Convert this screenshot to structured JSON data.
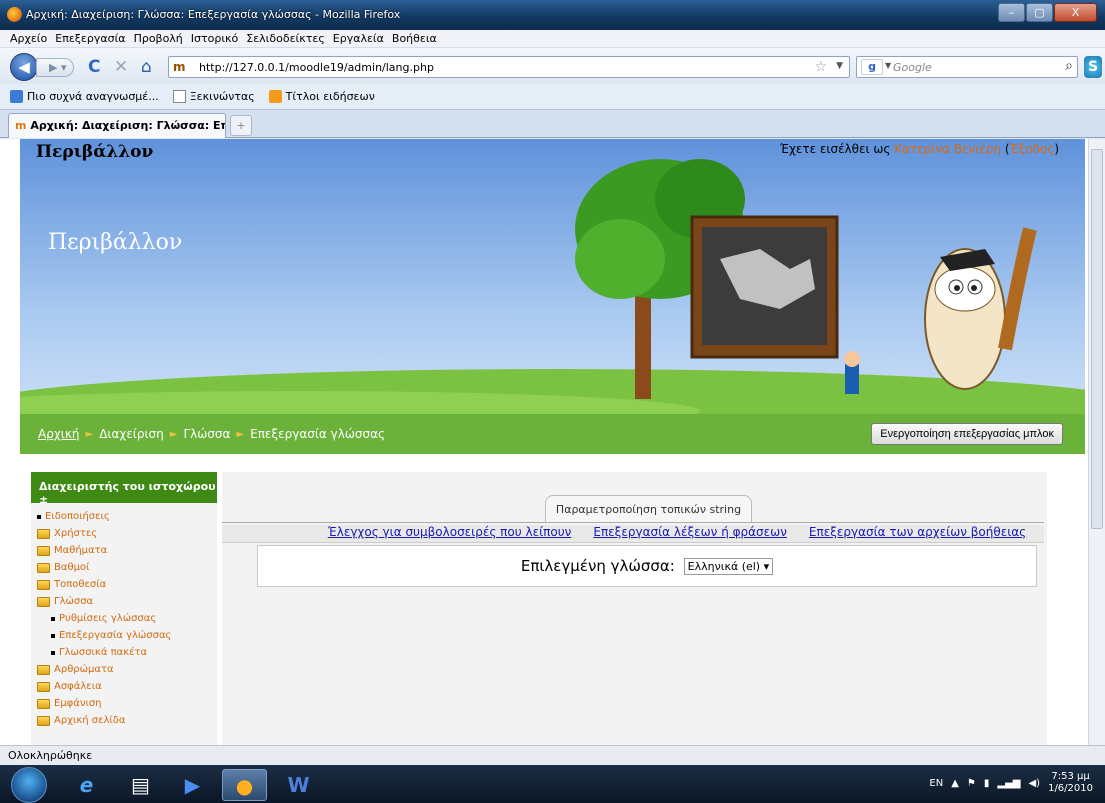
{
  "window": {
    "title": "Αρχική: Διαχείριση: Γλώσσα: Επεξεργασία γλώσσας - Mozilla Firefox",
    "controls": [
      "–",
      "▢",
      "X"
    ]
  },
  "menu": [
    "Αρχείο",
    "Επεξεργασία",
    "Προβολή",
    "Ιστορικό",
    "Σελιδοδείκτες",
    "Εργαλεία",
    "Βοήθεια"
  ],
  "nav": {
    "url": "http://127.0.0.1/moodle19/admin/lang.php",
    "site_icon": "m",
    "search_placeholder": "Google",
    "search_engine_icon": "g"
  },
  "bookmarks": [
    "Πιο συχνά αναγνωσμέ...",
    "Ξεκινώντας",
    "Τίτλοι ειδήσεων"
  ],
  "tab": {
    "label": "Αρχική: Διαχείριση: Γλώσσα: Επεξερ...",
    "site_icon": "m",
    "new_tab": "+"
  },
  "header": {
    "site_name": "Περιβάλλον",
    "banner_title": "Περιβάλλον",
    "logged_in_prefix": "Έχετε εισέλθει ως",
    "user_name": "Κατερίνα Βενιέρη",
    "open_paren": "(",
    "logout_label": "Έξοδος",
    "close_paren": ")"
  },
  "breadcrumb": {
    "items": [
      "Αρχική",
      "Διαχείριση",
      "Γλώσσα",
      "Επεξεργασία γλώσσας"
    ],
    "separator": "►",
    "edit_button": "Ενεργοποίηση επεξεργασίας μπλοκ"
  },
  "sidebar": {
    "title": "Διαχειριστής του ιστοχώρου",
    "title_icon": "±",
    "items": [
      {
        "label": "Ειδοποιήσεις",
        "icon": "bullet",
        "level": 0
      },
      {
        "label": "Χρήστες",
        "icon": "folder",
        "level": 0
      },
      {
        "label": "Μαθήματα",
        "icon": "folder",
        "level": 0
      },
      {
        "label": "Βαθμοί",
        "icon": "folder",
        "level": 0
      },
      {
        "label": "Τοποθεσία",
        "icon": "folder",
        "level": 0
      },
      {
        "label": "Γλώσσα",
        "icon": "folder-open",
        "level": 0
      },
      {
        "label": "Ρυθμίσεις γλώσσας",
        "icon": "bullet",
        "level": 1
      },
      {
        "label": "Επεξεργασία γλώσσας",
        "icon": "bullet",
        "level": 1
      },
      {
        "label": "Γλωσσικά πακέτα",
        "icon": "bullet",
        "level": 1
      },
      {
        "label": "Αρθρώματα",
        "icon": "folder",
        "level": 0
      },
      {
        "label": "Ασφάλεια",
        "icon": "folder",
        "level": 0
      },
      {
        "label": "Εμφάνιση",
        "icon": "folder",
        "level": 0
      },
      {
        "label": "Αρχική σελίδα",
        "icon": "folder",
        "level": 0
      }
    ]
  },
  "main": {
    "tab_label": "Παραμετροποίηση τοπικών string",
    "links": [
      "Έλεγχος για συμβολοσειρές που λείπουν",
      "Επεξεργασία λέξεων ή φράσεων",
      "Επεξεργασία των αρχείων βοήθειας"
    ],
    "lang_label": "Επιλεγμένη γλώσσα:",
    "lang_selected": "Ελληνικά (el)"
  },
  "status": "Ολοκληρώθηκε",
  "taskbar": {
    "lang": "EN",
    "time": "7:53 μμ",
    "date": "1/6/2010"
  },
  "colors": {
    "breadcrumb_bg": "#6bb23a",
    "sidebar_header": "#3e8a14",
    "link_orange": "#d26a10",
    "link_blue": "#1a1ab0"
  }
}
